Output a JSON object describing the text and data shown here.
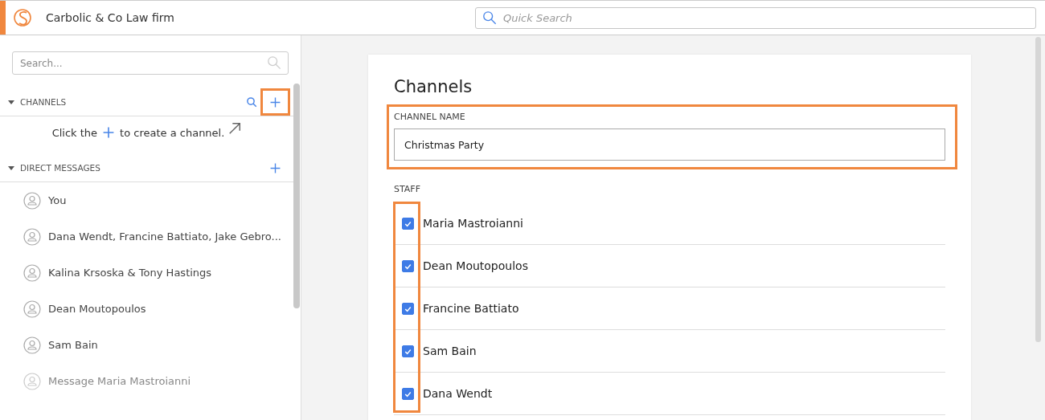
{
  "header": {
    "title": "Carbolic & Co Law firm",
    "quick_search": {
      "placeholder": "Quick Search"
    }
  },
  "sidebar": {
    "search": {
      "placeholder": "Search..."
    },
    "channels": {
      "label": "CHANNELS",
      "expanded": true,
      "hint": {
        "before": "Click the",
        "after": "to create a channel."
      }
    },
    "direct_messages": {
      "label": "DIRECT MESSAGES",
      "expanded": true,
      "items": [
        {
          "label": "You",
          "kind": "conversation"
        },
        {
          "label": "Dana Wendt, Francine Battiato, Jake Gebro...",
          "kind": "conversation"
        },
        {
          "label": "Kalina Krsoska & Tony Hastings",
          "kind": "conversation"
        },
        {
          "label": "Dean Moutopoulos",
          "kind": "conversation"
        },
        {
          "label": "Sam Bain",
          "kind": "conversation"
        },
        {
          "label": "Message Maria Mastroianni",
          "kind": "suggestion"
        }
      ]
    }
  },
  "form": {
    "title": "Channels",
    "channel_name": {
      "label": "CHANNEL NAME",
      "value": "Christmas Party"
    },
    "staff": {
      "label": "STAFF",
      "members": [
        {
          "name": "Maria Mastroianni",
          "checked": true
        },
        {
          "name": "Dean Moutopoulos",
          "checked": true
        },
        {
          "name": "Francine Battiato",
          "checked": true
        },
        {
          "name": "Sam Bain",
          "checked": true
        },
        {
          "name": "Dana Wendt",
          "checked": true
        }
      ]
    }
  }
}
